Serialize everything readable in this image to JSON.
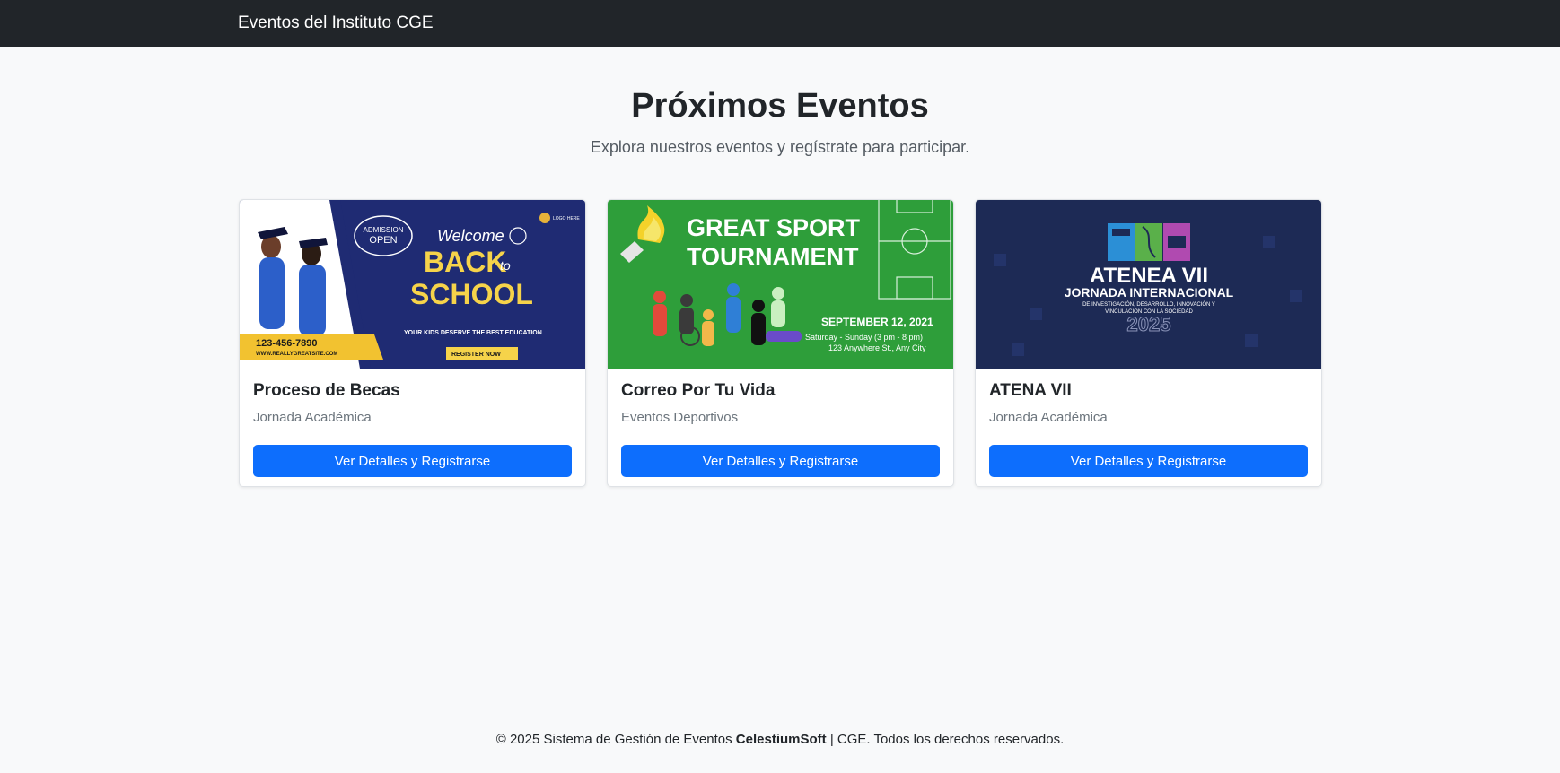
{
  "navbar": {
    "brand": "Eventos del Instituto CGE"
  },
  "hero": {
    "title": "Próximos Eventos",
    "subtitle": "Explora nuestros eventos y regístrate para participar."
  },
  "events": [
    {
      "title": "Proceso de Becas",
      "category": "Jornada Académica",
      "button_label": "Ver Detalles y Registrarse",
      "image": {
        "badge_line1": "ADMISSION",
        "badge_line2": "OPEN",
        "welcome": "Welcome",
        "back": "BACK",
        "to": "to",
        "school": "SCHOOL",
        "tagline": "YOUR KIDS DESERVE THE BEST EDUCATION",
        "phone": "123-456-7890",
        "site": "WWW.REALLYGREATSITE.COM",
        "register": "REGISTER NOW",
        "logo": "LOGO HERE"
      }
    },
    {
      "title": "Correo Por Tu Vida",
      "category": "Eventos Deportivos",
      "button_label": "Ver Detalles y Registrarse",
      "image": {
        "line1": "GREAT SPORT",
        "line2": "TOURNAMENT",
        "date": "SEPTEMBER 12, 2021",
        "time": "Saturday - Sunday (3 pm - 8 pm)",
        "address": "123 Anywhere St., Any City"
      }
    },
    {
      "title": "ATENA VII",
      "category": "Jornada Académica",
      "button_label": "Ver Detalles y Registrarse",
      "image": {
        "title": "ATENEA VII",
        "subtitle": "JORNADA INTERNACIONAL",
        "line1": "DE INVESTIGACIÓN, DESARROLLO, INNOVACIÓN Y",
        "line2": "VINCULACIÓN CON LA SOCIEDAD",
        "year": "2025"
      }
    }
  ],
  "footer": {
    "prefix": "© 2025 Sistema de Gestión de Eventos ",
    "brand": "CelestiumSoft",
    "suffix": " | CGE. Todos los derechos reservados."
  },
  "colors": {
    "navbar_bg": "#212529",
    "primary_button": "#0d6efd",
    "page_bg": "#f8f9fa",
    "school_bg": "#1f2b73",
    "sport_bg": "#2e9e3a",
    "atenea_bg": "#1d2a55"
  }
}
